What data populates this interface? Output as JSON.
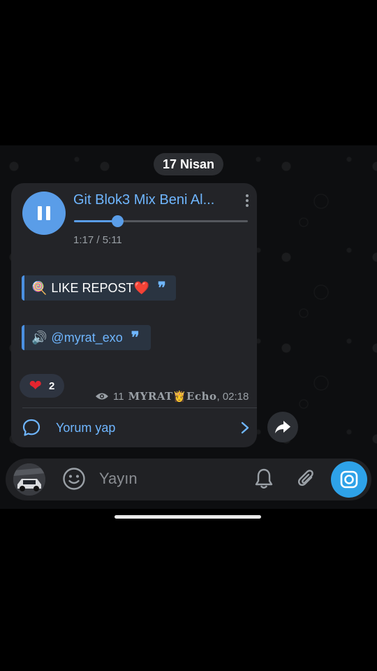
{
  "date_label": "17 Nisan",
  "audio": {
    "title": "Git Blok3 Mix Beni Al...",
    "time": "1:17 / 5:11",
    "progress": 0.25
  },
  "quotes": [
    {
      "emoji": "🍭",
      "text": "LIKE REPOST❤️",
      "mark": "❞"
    },
    {
      "emoji": "🔊",
      "text": "@myrat_exo",
      "mark": "❞"
    }
  ],
  "reaction": {
    "emoji": "❤",
    "count": "2"
  },
  "meta": {
    "views": "11",
    "signature": "MYRAT👸Echo",
    "time": ", 02:18"
  },
  "comment": {
    "label": "Yorum yap"
  },
  "input": {
    "placeholder": "Yayın"
  },
  "colors": {
    "accent": "#5a9de8",
    "link": "#6fb6ff",
    "bubble": "#232428",
    "camera": "#2ea2e8"
  },
  "icons": [
    "pause-icon",
    "more-vert-icon",
    "eye-icon",
    "comment-icon",
    "chevron-right-icon",
    "share-icon",
    "emoji-icon",
    "bell-icon",
    "paperclip-icon",
    "camera-icon"
  ]
}
